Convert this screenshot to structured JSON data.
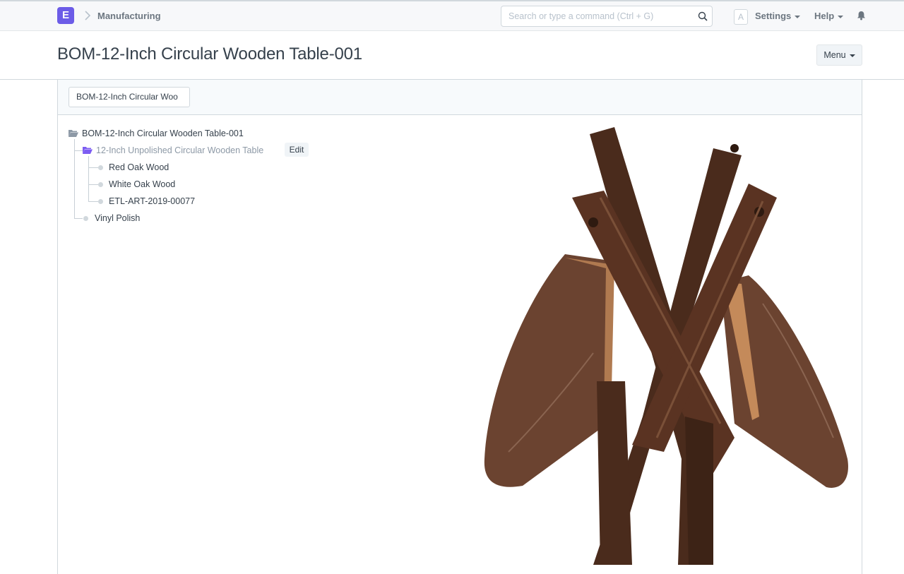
{
  "navbar": {
    "logo_letter": "E",
    "breadcrumb": "Manufacturing",
    "search_placeholder": "Search or type a command (Ctrl + G)",
    "avatar_letter": "A",
    "settings_label": "Settings",
    "help_label": "Help"
  },
  "page": {
    "title": "BOM-12-Inch Circular Wooden Table-001",
    "menu_label": "Menu"
  },
  "filter": {
    "value": "BOM-12-Inch Circular Woo"
  },
  "tree": {
    "root": "BOM-12-Inch Circular Wooden Table-001",
    "sub_assembly": "12-Inch Unpolished Circular Wooden Table",
    "edit_label": "Edit",
    "sub_items": [
      "Red Oak Wood",
      "White Oak Wood",
      "ETL-ART-2019-00077"
    ],
    "leaf": "Vinyl Polish"
  },
  "colors": {
    "brand": "#6c5ce7",
    "wood_dark": "#4a2b1c",
    "wood_mid": "#6b4330",
    "wood_light": "#8a6450"
  },
  "icons": {
    "search": "search-icon",
    "bell": "bell-icon",
    "folder": "folder-icon",
    "chevron": "chevron-right-icon"
  }
}
